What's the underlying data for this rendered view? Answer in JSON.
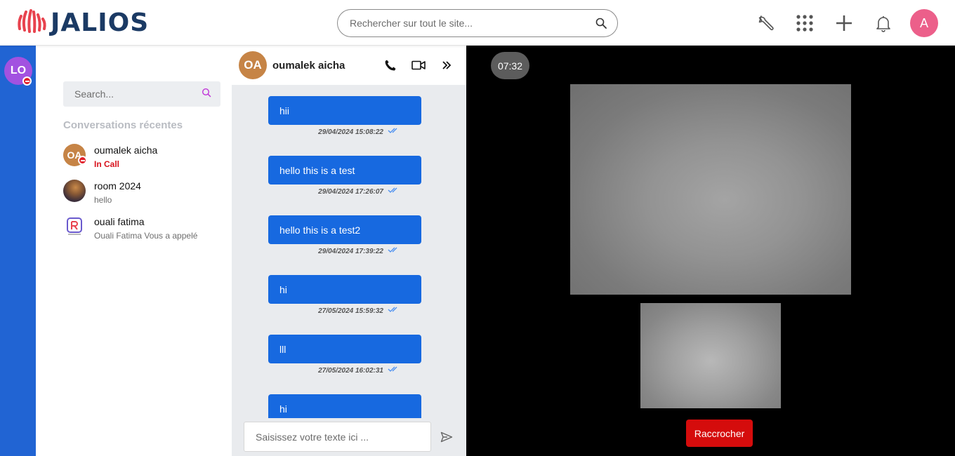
{
  "topbar": {
    "logo_text": "JALIOS",
    "search_placeholder": "Rechercher sur tout le site...",
    "avatar_initial": "A",
    "colors": {
      "logo_red": "#e8434e",
      "logo_navy": "#1b3a64",
      "avatar": "#ec5f8a"
    },
    "icons": [
      "wrench-icon",
      "apps-grid-icon",
      "plus-icon",
      "bell-icon"
    ]
  },
  "me": {
    "initials": "LO",
    "presence": "dnd",
    "color": "#a252e0"
  },
  "conversations": {
    "search_placeholder": "Search...",
    "section_title": "Conversations récentes",
    "items": [
      {
        "initials": "OA",
        "name": "oumalek aicha",
        "sub": "In Call",
        "status": "in-call"
      },
      {
        "initials": "",
        "name": "room 2024",
        "sub": "hello",
        "status": ""
      },
      {
        "initials": "",
        "name": "ouali fatima",
        "sub": "Ouali Fatima Vous a appelé",
        "status": ""
      }
    ]
  },
  "chat": {
    "contact_initials": "OA",
    "contact_name": "oumalek aicha",
    "messages": [
      {
        "text": "hii",
        "time": "29/04/2024 15:08:22"
      },
      {
        "text": "hello this is a test",
        "time": "29/04/2024 17:26:07"
      },
      {
        "text": "hello this is a test2",
        "time": "29/04/2024 17:39:22"
      },
      {
        "text": "hi",
        "time": "27/05/2024 15:59:32"
      },
      {
        "text": "lll",
        "time": "27/05/2024 16:02:31"
      },
      {
        "text": "hi",
        "time": ""
      }
    ],
    "composer_placeholder": "Saisissez votre texte ici ...",
    "colors": {
      "bubble": "#1769e0",
      "panel": "#e9ebee"
    }
  },
  "call": {
    "timer": "07:32",
    "hangup_label": "Raccrocher",
    "colors": {
      "hangup": "#d50c0c"
    }
  }
}
